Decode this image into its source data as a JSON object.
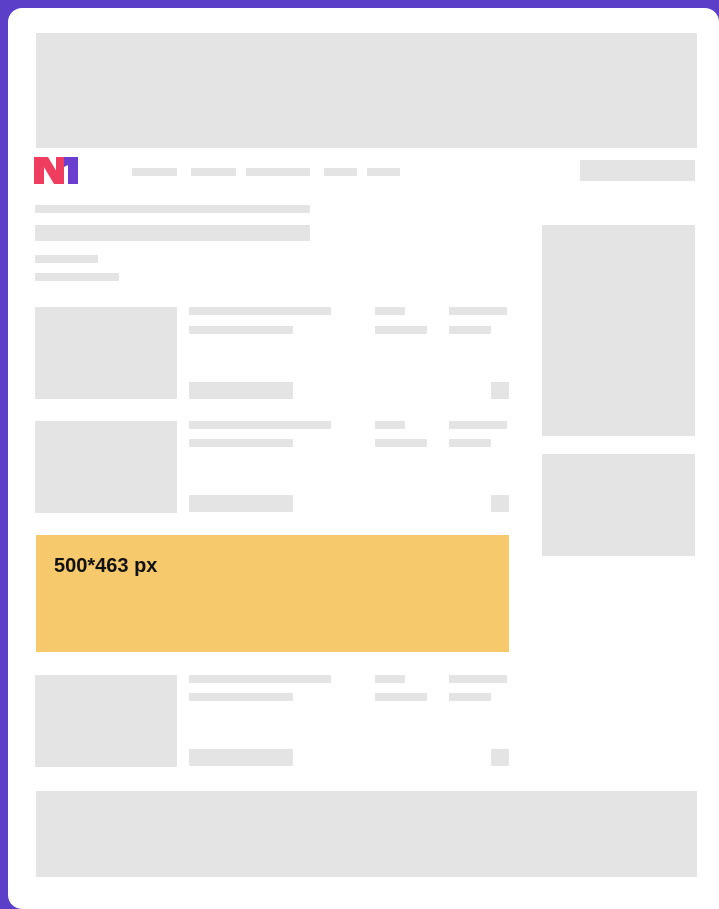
{
  "ad_slot": {
    "label": "500*463 px"
  },
  "colors": {
    "frame": "#5b3fc8",
    "placeholder": "#e4e4e4",
    "ad_fill": "#f7c96d",
    "logo_red": "#ee3d5e",
    "logo_purple": "#6a3fd0"
  },
  "icons": {
    "logo": "site-logo-n1"
  }
}
